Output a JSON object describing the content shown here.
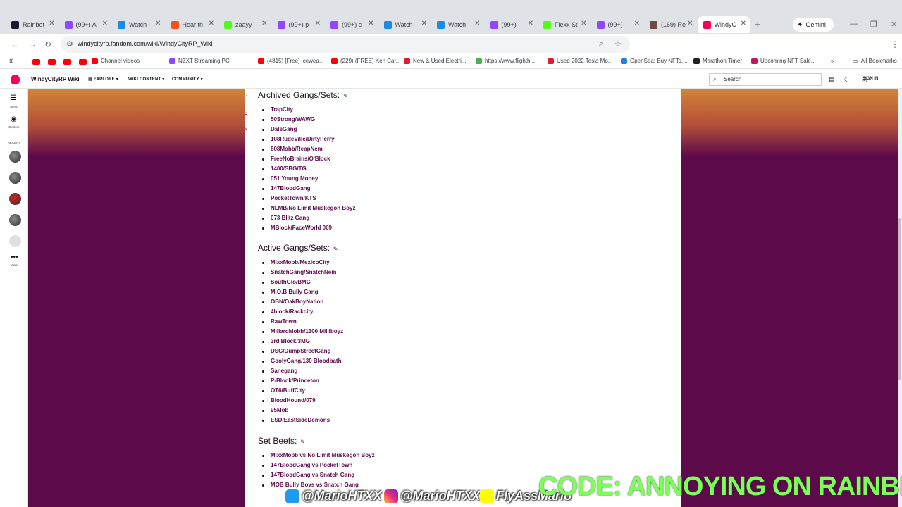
{
  "browser": {
    "tabs": [
      {
        "label": "Rainbet",
        "fav_color": "#1a1a2e",
        "icon": "rainbet-icon"
      },
      {
        "label": "(99+) A",
        "fav_color": "#9146ff",
        "icon": "twitch-icon"
      },
      {
        "label": "Watch",
        "fav_color": "#1e88e5",
        "icon": "kick-watch-icon"
      },
      {
        "label": "Hear th",
        "fav_color": "#f4511e",
        "icon": "page-icon"
      },
      {
        "label": "zaayy",
        "fav_color": "#53fc18",
        "icon": "kick-icon"
      },
      {
        "label": "(99+) p",
        "fav_color": "#9146ff",
        "icon": "twitch-icon"
      },
      {
        "label": "(99+) c",
        "fav_color": "#9146ff",
        "icon": "twitch-icon"
      },
      {
        "label": "Watch",
        "fav_color": "#1e88e5",
        "icon": "kick-watch-icon"
      },
      {
        "label": "Watch",
        "fav_color": "#1e88e5",
        "icon": "kick-watch-icon"
      },
      {
        "label": "(99+)",
        "fav_color": "#9146ff",
        "icon": "twitch-icon"
      },
      {
        "label": "Flexx St",
        "fav_color": "#53fc18",
        "icon": "kick-icon"
      },
      {
        "label": "(99+)",
        "fav_color": "#9146ff",
        "icon": "twitch-icon"
      },
      {
        "label": "(169) Re",
        "fav_color": "#6d4c41",
        "icon": "page-icon"
      },
      {
        "label": "WindyC",
        "fav_color": "#fa005a",
        "icon": "fandom-icon",
        "active": true
      }
    ],
    "new_tab": "+",
    "gemini_label": "Gemini",
    "url": "windycityrp.fandom.com/wiki/WindyCityRP_Wiki"
  },
  "bookmarks": [
    {
      "label": "Channel videos",
      "color": "#ff0000"
    },
    {
      "label": "NZXT Streaming PC",
      "color": "#9146ff"
    },
    {
      "label": "(4815) [Free] Icewea...",
      "color": "#ff0000"
    },
    {
      "label": "(229) (FREE) Ken Car...",
      "color": "#ff0000"
    },
    {
      "label": "New & Used Electri...",
      "color": "#e31937"
    },
    {
      "label": "https://www.flighth...",
      "color": "#4caf50"
    },
    {
      "label": "Used 2022 Tesla Mo...",
      "color": "#e31937"
    },
    {
      "label": "OpenSea: Buy NFTs,...",
      "color": "#2081e2"
    },
    {
      "label": "Marathon Timer",
      "color": "#202124"
    },
    {
      "label": "Upcoming NFT Sale...",
      "color": "#c2185b"
    }
  ],
  "all_bookmarks": "All Bookmarks",
  "fandom": {
    "wiki_name": "WindyCityRP Wiki",
    "nav": [
      "EXPLORE",
      "WIKI CONTENT",
      "COMMUNITY"
    ],
    "search_placeholder": "Search",
    "sign_in": "SIGN IN",
    "rail": {
      "menu": "Menu",
      "explore": "Explore",
      "recent": "RECENT",
      "more": "More"
    }
  },
  "sections": [
    {
      "title": "Archived Gangs/Sets:",
      "items": [
        "TrapCity",
        "50Strong/WAWG",
        "DaleGang",
        "108RudeVille/DirtyPerry",
        "808Mobb/ReapNem",
        "FreeNoBrains/O'Block",
        "1400/SBG/TG",
        "051 Young Money",
        "147BloodGang",
        "PocketTown/KTS",
        "NLMB/No Limit Muskegon Boyz",
        "073 Blitz Gang",
        "MBlock/FaceWorld 069"
      ]
    },
    {
      "title": "Active Gangs/Sets:",
      "items": [
        "MixxMobb/MexicoCity",
        "SnatchGang/SnatchNem",
        "SouthGlo/BMG",
        "M.O.B Bully Gang",
        "OBN/OakBoyNation",
        "4block/Rackcity",
        "RawTown",
        "MillardMobb/1300 Milliboyz",
        "3rd Block/3MG",
        "DSG/DumpStreetGang",
        "GoolyGang/130 Bloodbath",
        "Sanegang",
        "P-Block/Princeton",
        "OT6/BuffCity",
        "BloodHound/079",
        "95Mob",
        "ESD/EastSideDemons"
      ]
    },
    {
      "title": "Set Beefs:",
      "items": [
        "MixxMobb vs No Limit Muskegon Boyz",
        "147BloodGang vs PocketTown",
        "147BloodGang vs Snatch Gang",
        "MOB Bully Boys vs Snatch Gang"
      ]
    }
  ],
  "overlay": {
    "code": "CODE: ANNOYING ON RAINBET",
    "twitter": "@MarioHTXX",
    "instagram": "@MarioHTXX",
    "snapchat": "FlyAssMario"
  },
  "colors": {
    "wiki_purple": "#5d0a4b",
    "link": "#5d0a4b",
    "fandom_pink": "#fa005a",
    "code_green": "#7cff59"
  }
}
